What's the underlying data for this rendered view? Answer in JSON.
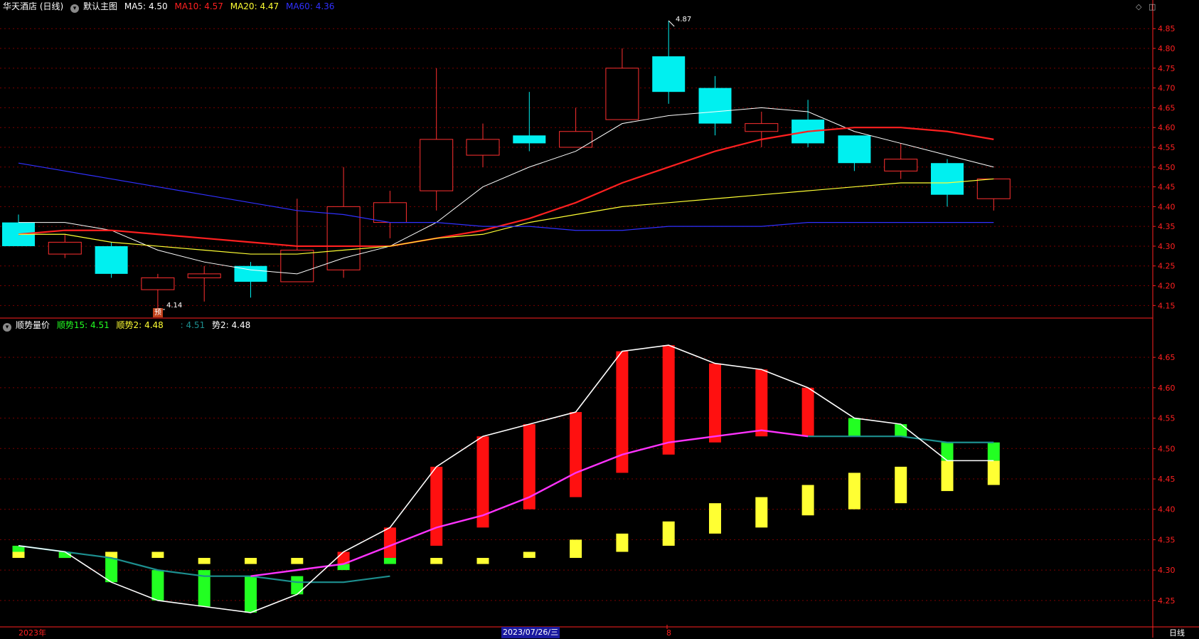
{
  "main_header": {
    "title": "华天酒店 (日线)",
    "template": "默认主图",
    "ma5": {
      "label": "MA5:",
      "value": "4.50",
      "color": "#ffffff"
    },
    "ma10": {
      "label": "MA10:",
      "value": "4.57",
      "color": "#ff2020"
    },
    "ma20": {
      "label": "MA20:",
      "value": "4.47",
      "color": "#ffff33"
    },
    "ma60": {
      "label": "MA60:",
      "value": "4.36",
      "color": "#3030ff"
    }
  },
  "sub_header": {
    "title": "顺势量价",
    "s1": {
      "label": "顺势15:",
      "value": "4.51",
      "color": "#22ff22"
    },
    "s2": {
      "label": "顺势2:",
      "value": "4.48",
      "color": "#ffff33"
    },
    "s3": {
      "label": ":",
      "value": "4.51",
      "color": "#1d8f8f"
    },
    "s4": {
      "label": "势2:",
      "value": "4.48",
      "color": "#ffffff"
    }
  },
  "bottom_bar": {
    "year": "2023年",
    "date": "2023/07/26/三",
    "marker": "8",
    "period": "日线"
  },
  "markers": {
    "high": "4.87",
    "low": "4.14",
    "forecast": "预"
  },
  "colors": {
    "up": "#ff3030",
    "down": "#00f0f0",
    "grid": "#7a0000",
    "axis": "#ff2020"
  },
  "chart_data": [
    {
      "type": "candlestick",
      "title": "华天酒店 (日线)",
      "ylim": [
        4.12,
        4.89
      ],
      "yticks": [
        4.15,
        4.2,
        4.25,
        4.3,
        4.35,
        4.4,
        4.45,
        4.5,
        4.55,
        4.6,
        4.65,
        4.7,
        4.75,
        4.8,
        4.85
      ],
      "candles": [
        {
          "o": 4.36,
          "h": 4.38,
          "l": 4.3,
          "c": 4.3
        },
        {
          "o": 4.28,
          "h": 4.33,
          "l": 4.27,
          "c": 4.31
        },
        {
          "o": 4.3,
          "h": 4.31,
          "l": 4.22,
          "c": 4.23
        },
        {
          "o": 4.19,
          "h": 4.23,
          "l": 4.14,
          "c": 4.22
        },
        {
          "o": 4.22,
          "h": 4.25,
          "l": 4.16,
          "c": 4.23
        },
        {
          "o": 4.25,
          "h": 4.26,
          "l": 4.17,
          "c": 4.21
        },
        {
          "o": 4.21,
          "h": 4.42,
          "l": 4.21,
          "c": 4.29
        },
        {
          "o": 4.24,
          "h": 4.5,
          "l": 4.22,
          "c": 4.4
        },
        {
          "o": 4.36,
          "h": 4.44,
          "l": 4.32,
          "c": 4.41
        },
        {
          "o": 4.44,
          "h": 4.75,
          "l": 4.39,
          "c": 4.57
        },
        {
          "o": 4.53,
          "h": 4.61,
          "l": 4.5,
          "c": 4.57
        },
        {
          "o": 4.58,
          "h": 4.69,
          "l": 4.54,
          "c": 4.56
        },
        {
          "o": 4.55,
          "h": 4.65,
          "l": 4.55,
          "c": 4.59
        },
        {
          "o": 4.62,
          "h": 4.8,
          "l": 4.62,
          "c": 4.75
        },
        {
          "o": 4.78,
          "h": 4.87,
          "l": 4.66,
          "c": 4.69
        },
        {
          "o": 4.7,
          "h": 4.73,
          "l": 4.58,
          "c": 4.61
        },
        {
          "o": 4.59,
          "h": 4.64,
          "l": 4.55,
          "c": 4.61
        },
        {
          "o": 4.62,
          "h": 4.67,
          "l": 4.55,
          "c": 4.56
        },
        {
          "o": 4.58,
          "h": 4.58,
          "l": 4.49,
          "c": 4.51
        },
        {
          "o": 4.49,
          "h": 4.56,
          "l": 4.47,
          "c": 4.52
        },
        {
          "o": 4.51,
          "h": 4.52,
          "l": 4.4,
          "c": 4.43
        },
        {
          "o": 4.42,
          "h": 4.47,
          "l": 4.39,
          "c": 4.47
        }
      ],
      "series": [
        {
          "name": "MA5",
          "color": "#ffffff",
          "values": [
            4.36,
            4.36,
            4.34,
            4.29,
            4.26,
            4.24,
            4.23,
            4.27,
            4.3,
            4.36,
            4.45,
            4.5,
            4.54,
            4.61,
            4.63,
            4.64,
            4.65,
            4.64,
            4.59,
            4.56,
            4.53,
            4.5
          ]
        },
        {
          "name": "MA10",
          "color": "#ff2020",
          "values": [
            4.33,
            4.34,
            4.34,
            4.33,
            4.32,
            4.31,
            4.3,
            4.3,
            4.3,
            4.32,
            4.34,
            4.37,
            4.41,
            4.46,
            4.5,
            4.54,
            4.57,
            4.59,
            4.6,
            4.6,
            4.59,
            4.57
          ]
        },
        {
          "name": "MA20",
          "color": "#ffff33",
          "values": [
            4.33,
            4.33,
            4.31,
            4.3,
            4.29,
            4.28,
            4.28,
            4.29,
            4.3,
            4.32,
            4.33,
            4.36,
            4.38,
            4.4,
            4.41,
            4.42,
            4.43,
            4.44,
            4.45,
            4.46,
            4.46,
            4.47
          ]
        },
        {
          "name": "MA60",
          "color": "#3030ff",
          "values": [
            4.51,
            4.49,
            4.47,
            4.45,
            4.43,
            4.41,
            4.39,
            4.38,
            4.36,
            4.36,
            4.35,
            4.35,
            4.34,
            4.34,
            4.35,
            4.35,
            4.35,
            4.36,
            4.36,
            4.36,
            4.36,
            4.36
          ]
        }
      ]
    },
    {
      "type": "bar",
      "title": "顺势量价",
      "ylim": [
        4.21,
        4.69
      ],
      "yticks": [
        4.25,
        4.3,
        4.35,
        4.4,
        4.45,
        4.5,
        4.55,
        4.6,
        4.65
      ],
      "white_line": [
        4.34,
        4.33,
        4.28,
        4.25,
        4.24,
        4.23,
        4.26,
        4.33,
        4.37,
        4.47,
        4.52,
        4.54,
        4.56,
        4.66,
        4.67,
        4.64,
        4.63,
        4.6,
        4.55,
        4.54,
        4.48,
        4.48
      ],
      "teal_line": [
        4.34,
        4.33,
        4.32,
        4.3,
        4.29,
        4.29,
        4.28,
        4.28,
        4.29
      ],
      "magenta_line": [
        4.29,
        4.3,
        4.31,
        4.34,
        4.37,
        4.39,
        4.42,
        4.46,
        4.49,
        4.51,
        4.52,
        4.53,
        4.52
      ],
      "green_bars": [
        [
          4.33,
          4.34
        ],
        [
          4.32,
          4.33
        ],
        [
          4.28,
          4.32
        ],
        [
          4.25,
          4.3
        ],
        [
          4.24,
          4.3
        ],
        [
          4.23,
          4.29
        ],
        [
          4.26,
          4.29
        ],
        [
          4.3,
          4.31
        ],
        [
          4.31,
          4.32
        ],
        null,
        null,
        null,
        null,
        null,
        null,
        null,
        null,
        null,
        [
          4.52,
          4.55
        ],
        [
          4.52,
          4.54
        ],
        [
          4.48,
          4.51
        ],
        [
          4.48,
          4.51
        ]
      ],
      "red_bars": [
        [
          4.33,
          4.34
        ],
        null,
        null,
        null,
        null,
        null,
        null,
        [
          4.31,
          4.33
        ],
        [
          4.32,
          4.37
        ],
        [
          4.34,
          4.47
        ],
        [
          4.37,
          4.52
        ],
        [
          4.4,
          4.54
        ],
        [
          4.42,
          4.56
        ],
        [
          4.46,
          4.66
        ],
        [
          4.49,
          4.67
        ],
        [
          4.51,
          4.64
        ],
        [
          4.52,
          4.63
        ],
        [
          4.52,
          4.6
        ],
        null,
        null,
        null,
        null
      ],
      "yellow_bars": [
        [
          4.32,
          4.33
        ],
        [
          4.32,
          4.33
        ],
        [
          4.32,
          4.33
        ],
        [
          4.32,
          4.33
        ],
        [
          4.31,
          4.32
        ],
        [
          4.31,
          4.32
        ],
        [
          4.31,
          4.32
        ],
        null,
        null,
        [
          4.31,
          4.32
        ],
        [
          4.31,
          4.32
        ],
        [
          4.32,
          4.33
        ],
        [
          4.32,
          4.35
        ],
        [
          4.33,
          4.36
        ],
        [
          4.34,
          4.38
        ],
        [
          4.36,
          4.41
        ],
        [
          4.37,
          4.42
        ],
        [
          4.39,
          4.44
        ],
        [
          4.4,
          4.46
        ],
        [
          4.41,
          4.47
        ],
        [
          4.43,
          4.48
        ],
        [
          4.44,
          4.48
        ]
      ],
      "series": [
        {
          "name": "顺势15",
          "color": "#22ff22",
          "value": 4.51
        },
        {
          "name": "顺势2",
          "color": "#ffff33",
          "value": 4.48
        },
        {
          "name": "势2",
          "color": "#ffffff",
          "value": 4.48
        }
      ]
    }
  ]
}
